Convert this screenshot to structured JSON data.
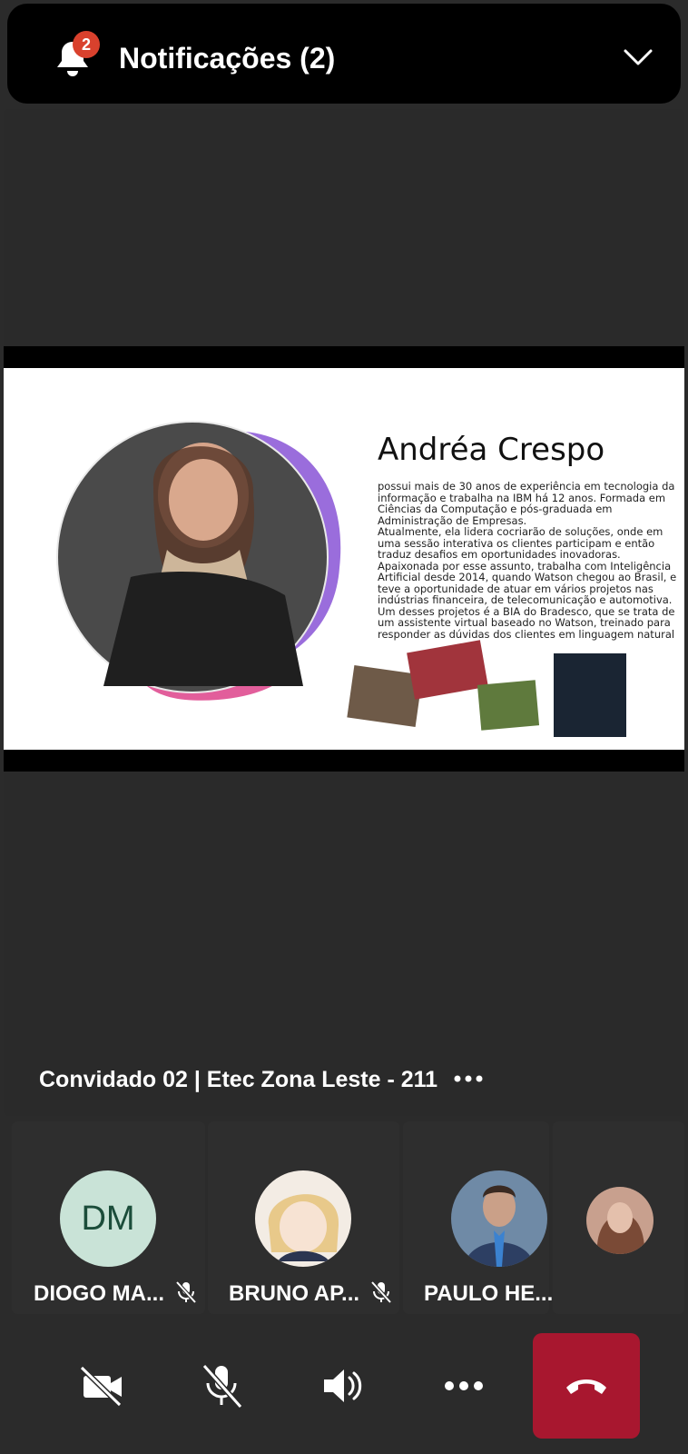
{
  "notifications": {
    "title": "Notificações (2)",
    "badge_count": "2",
    "badge_color": "#d9412d"
  },
  "slide": {
    "name": "Andréa Crespo",
    "bio": [
      "possui mais de 30 anos de experiência em tecnologia da informação e trabalha na IBM há 12 anos. Formada em Ciências da Computação e pós-graduada em Administração de Empresas.",
      "Atualmente, ela lidera cocriarão de soluções, onde em uma sessão interativa os clientes participam e então traduz desafios em oportunidades inovadoras.",
      "Apaixonada por esse assunto, trabalha com Inteligência Artificial desde 2014, quando Watson chegou ao Brasil, e teve a oportunidade de atuar em vários projetos nas indústrias financeira, de telecomunicação e automotiva. Um desses projetos é a BIA do Bradesco, que se trata de um assistente virtual baseado no Watson, treinado para responder as dúvidas dos clientes em linguagem natural"
    ]
  },
  "stage": {
    "label": "Convidado 02 | Etec Zona Leste - 211",
    "more_icon": "more-horizontal-icon"
  },
  "participants": [
    {
      "name": "DIOGO MA...",
      "initials": "DM",
      "muted": true
    },
    {
      "name": "BRUNO AP...",
      "muted": true
    },
    {
      "name": "PAULO HE...",
      "muted": false
    },
    {
      "name": ""
    }
  ],
  "controls": {
    "camera_icon": "camera-off-icon",
    "mic_icon": "mic-off-icon",
    "speaker_icon": "speaker-icon",
    "more_icon": "more-horizontal-icon",
    "hangup_icon": "phone-hangup-icon",
    "hangup_color": "#a8172f"
  }
}
